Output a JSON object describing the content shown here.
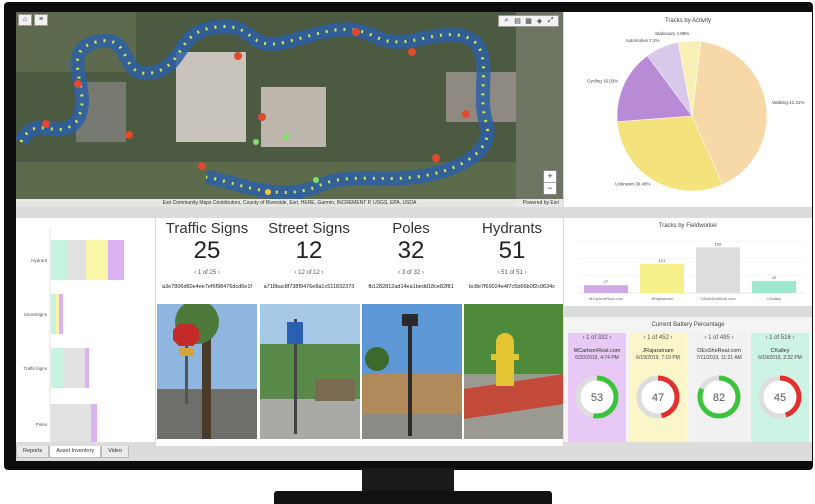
{
  "map": {
    "attribution": "Esri Community Maps Contributors, County of Riverside, Esri, HERE, Garmin, INCREMENT P, USGS, EPA, USDA",
    "powered_by": "Powered by Esri"
  },
  "pie": {
    "title": "Tracks by Activity",
    "chart_data": {
      "type": "pie",
      "title": "Tracks by Activity",
      "slices": [
        {
          "label": "Walking 41.41%",
          "value": 41.41,
          "color": "#f7d9a8"
        },
        {
          "label": "Unknown 30.48%",
          "value": 30.48,
          "color": "#f4e27c"
        },
        {
          "label": "Cycling 16.03%",
          "value": 16.03,
          "color": "#b98bd6"
        },
        {
          "label": "Automotive 7.2%",
          "value": 7.2,
          "color": "#d8c8ea"
        },
        {
          "label": "Stationary 4.88%",
          "value": 4.88,
          "color": "#f9f0b6"
        }
      ]
    }
  },
  "bars": {
    "title": "Tracks by Fieldworker",
    "chart_data": {
      "type": "bar",
      "title": "Tracks by Fieldworker",
      "categories": [
        "MCarlsonReal.com",
        "JRajaratnam",
        "OEsteShaReal.com",
        "CKalley"
      ],
      "values": [
        27,
        101,
        158,
        42
      ],
      "colors": [
        "#cfa9e6",
        "#f6f08a",
        "#dddddd",
        "#9fe8cf"
      ]
    }
  },
  "battery": {
    "title": "Current Battery Percentage",
    "cards": [
      {
        "page": "1 of 332",
        "name": "MCarlsonReal.com",
        "time": "6/20/2019, 4:74 PM",
        "pct": 53,
        "bg": "#e8c8f5"
      },
      {
        "page": "1 of 452",
        "name": "JRajaratnam",
        "time": "6/19/2019, 7:19 PM",
        "pct": 47,
        "bg": "#fbf6c9"
      },
      {
        "page": "1 of 495",
        "name": "OEsSheReal.com",
        "time": "7/11/2019, 11:21 AM",
        "pct": 82,
        "bg": "#f1f1f1"
      },
      {
        "page": "1 of 516",
        "name": "CKalley",
        "time": "6/19/2019, 2:32 PM",
        "pct": 45,
        "bg": "#cdf3e4"
      }
    ]
  },
  "left_chart": {
    "categories": [
      "Hydrant",
      "StreetSigns",
      "TrafficSigns",
      "Poles"
    ]
  },
  "indicators": [
    {
      "label": "Traffic Signs",
      "value": "25",
      "page": "1 of 25",
      "guid": "a3e7806d60e4ee7ef6f98476dcd6e1f"
    },
    {
      "label": "Street Signs",
      "value": "12",
      "page": "12 of 12",
      "guid": "a718bac8f738f9476e8a1c511832373"
    },
    {
      "label": "Poles",
      "value": "32",
      "page": "3 of 32",
      "guid": "fb1282812ad14ea1bedd18ce82f81"
    },
    {
      "label": "Hydrants",
      "value": "51",
      "page": "51 of 51",
      "guid": "bc8e7f69024e4f7c5b66b0f2c0634c"
    }
  ],
  "tabs": [
    "Reports",
    "Asset Inventory",
    "Video"
  ]
}
